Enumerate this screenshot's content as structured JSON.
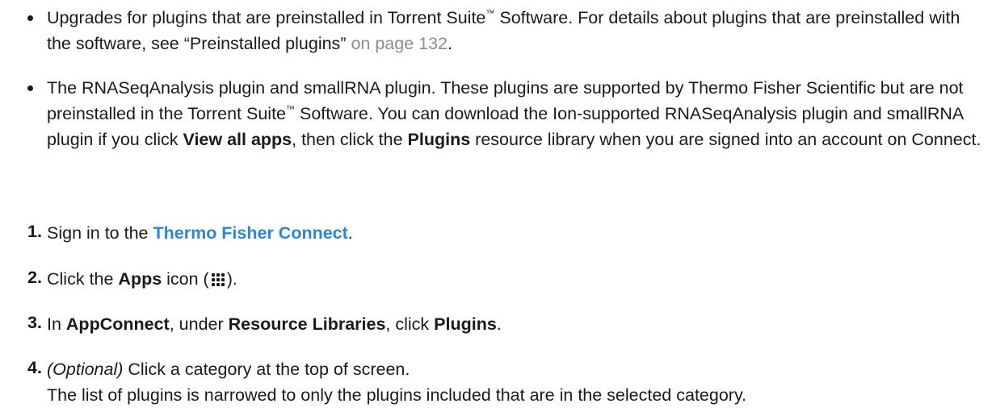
{
  "bullets": [
    {
      "a": "Upgrades for plugins that are preinstalled in Torrent Suite",
      "tm": "™",
      "b": " Software. For details about plugins that are preinstalled with the software, see “Preinstalled plugins” ",
      "ref": "on page 132",
      "c": "."
    },
    {
      "a": "The RNASeqAnalysis plugin and smallRNA plugin. These plugins are supported by Thermo Fisher Scientific but are not preinstalled in the Torrent Suite",
      "tm": "™",
      "b": " Software. You can download the Ion-supported RNASeqAnalysis plugin and smallRNA plugin if you click ",
      "bold1": "View all apps",
      "c": ", then click the ",
      "bold2": "Plugins",
      "d": " resource library when you are signed into an account on Connect."
    }
  ],
  "steps": [
    {
      "num": "1.",
      "a": "Sign in to the ",
      "link": "Thermo Fisher Connect",
      "b": "."
    },
    {
      "num": "2.",
      "a": "Click the ",
      "bold": "Apps",
      "b": " icon (",
      "icon": "apps-grid-icon",
      "c": ")."
    },
    {
      "num": "3.",
      "a": "In ",
      "bold1": "AppConnect",
      "b": ", under ",
      "bold2": "Resource Libraries",
      "c": ", click ",
      "bold3": "Plugins",
      "d": "."
    },
    {
      "num": "4.",
      "italic": "(Optional)",
      "a": " Click a category at the top of screen.",
      "result": "The list of plugins is narrowed to only the plugins included that are in the selected category."
    }
  ]
}
